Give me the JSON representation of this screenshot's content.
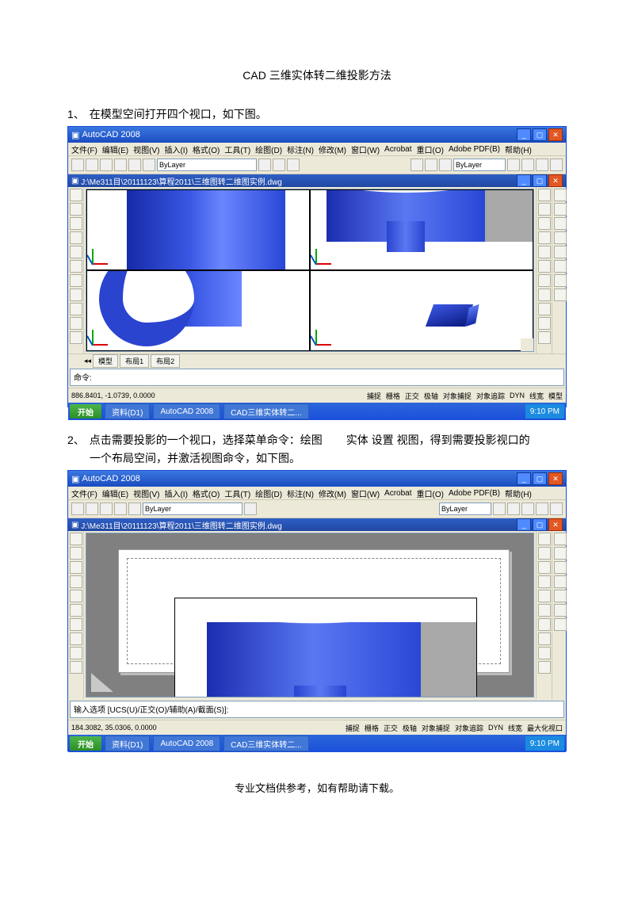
{
  "doc": {
    "title": "CAD 三维实体转二维投影方法",
    "step1_num": "1、",
    "step1": "在模型空间打开四个视口，如下图。",
    "step2_num": "2、",
    "step2a": "点击需要投影的一个视口，选择菜单命令：绘图",
    "step2b": "实体 设置 视图，得到需要投影视口的",
    "step2c": "一个布局空间，并激活视图命令，如下图。",
    "footer": "专业文档供参考，如有帮助请下载。"
  },
  "app": {
    "title": "AutoCAD 2008",
    "docpath": "J:\\Me311目\\20111123\\算程2011\\三维图转二维图实例.dwg",
    "menu": [
      "文件(F)",
      "编辑(E)",
      "视图(V)",
      "插入(I)",
      "格式(O)",
      "工具(T)",
      "绘图(D)",
      "标注(N)",
      "修改(M)",
      "窗口(W)",
      "Acrobat",
      "重口(O)",
      "Adobe PDF(B)",
      "帮助(H)"
    ],
    "layer": "ByLayer",
    "color": "ByLayer",
    "tabs": {
      "model": "模型",
      "l1": "布局1",
      "l2": "布局2"
    },
    "cmd1": "命令:",
    "cmd2": "输入选项 [UCS(U)/正交(O)/辅助(A)/截面(S)]:",
    "coords1": "886.8401, -1.0739, 0.0000",
    "coords2": "184.3082, 35.0306, 0.0000",
    "status": [
      "捕捉",
      "栅格",
      "正交",
      "极轴",
      "对象捕捉",
      "对象追踪",
      "DYN",
      "线宽",
      "模型"
    ],
    "status2": [
      "最大化视口",
      "▼",
      "—"
    ]
  },
  "taskbar": {
    "start": "开始",
    "items": [
      "资料(D1)",
      "AutoCAD 2008",
      "CAD三维实体转二..."
    ],
    "clock": "9:10 PM"
  }
}
